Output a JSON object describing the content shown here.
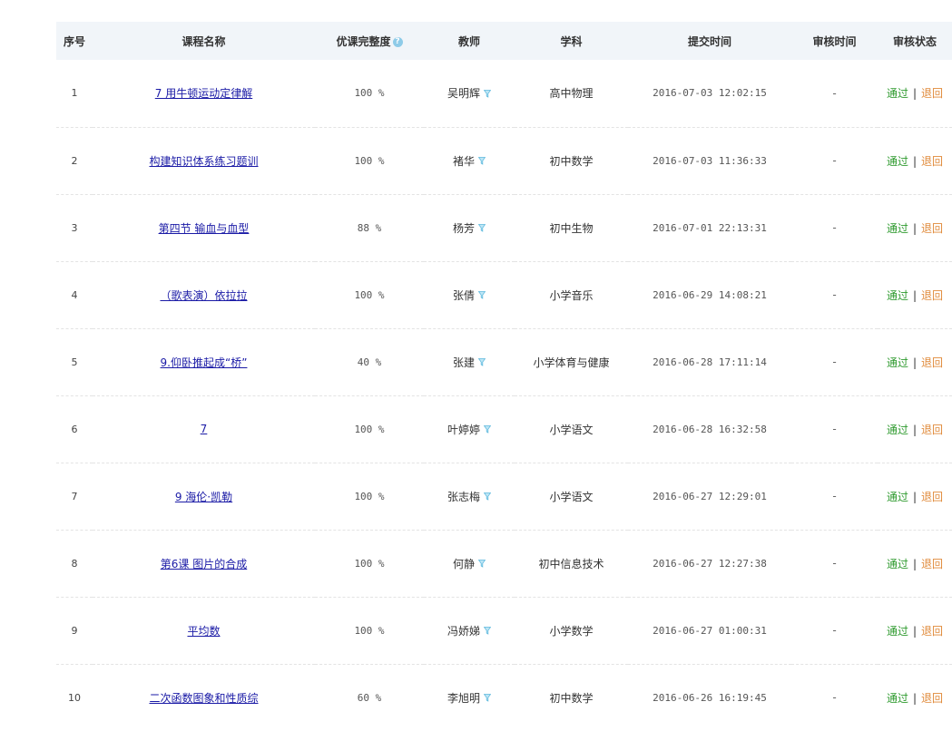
{
  "table": {
    "headers": {
      "idx": "序号",
      "name": "课程名称",
      "completeness": "优课完整度",
      "teacher": "教师",
      "subject": "学科",
      "submit_time": "提交时间",
      "review_time": "审核时间",
      "status": "审核状态"
    },
    "help_glyph": "?",
    "pass_label": "通过",
    "separator": "|",
    "back_label": "退回",
    "rows": [
      {
        "idx": "1",
        "name": "7  用牛顿运动定律解",
        "completeness": "100 %",
        "teacher": "吴明辉",
        "subject": "高中物理",
        "submit_time": "2016-07-03 12:02:15",
        "review_time": "-"
      },
      {
        "idx": "2",
        "name": "构建知识体系练习题训",
        "completeness": "100 %",
        "teacher": "褚华",
        "subject": "初中数学",
        "submit_time": "2016-07-03 11:36:33",
        "review_time": "-"
      },
      {
        "idx": "3",
        "name": "第四节  输血与血型",
        "completeness": "88 %",
        "teacher": "杨芳",
        "subject": "初中生物",
        "submit_time": "2016-07-01 22:13:31",
        "review_time": "-"
      },
      {
        "idx": "4",
        "name": "（歌表演）依拉拉",
        "completeness": "100 %",
        "teacher": "张倩",
        "subject": "小学音乐",
        "submit_time": "2016-06-29 14:08:21",
        "review_time": "-"
      },
      {
        "idx": "5",
        "name": "9.仰卧推起成“桥”",
        "completeness": "40 %",
        "teacher": "张建",
        "subject": "小学体育与健康",
        "submit_time": "2016-06-28 17:11:14",
        "review_time": "-"
      },
      {
        "idx": "6",
        "name": "7",
        "completeness": "100 %",
        "teacher": "叶婷婷",
        "subject": "小学语文",
        "submit_time": "2016-06-28 16:32:58",
        "review_time": "-"
      },
      {
        "idx": "7",
        "name": "9 海伦·凯勒",
        "completeness": "100 %",
        "teacher": "张志梅",
        "subject": "小学语文",
        "submit_time": "2016-06-27 12:29:01",
        "review_time": "-"
      },
      {
        "idx": "8",
        "name": "第6课 图片的合成",
        "completeness": "100 %",
        "teacher": "何静",
        "subject": "初中信息技术",
        "submit_time": "2016-06-27 12:27:38",
        "review_time": "-"
      },
      {
        "idx": "9",
        "name": "平均数",
        "completeness": "100 %",
        "teacher": "冯娇娣",
        "subject": "小学数学",
        "submit_time": "2016-06-27 01:00:31",
        "review_time": "-"
      },
      {
        "idx": "10",
        "name": "二次函数图象和性质综",
        "completeness": "60 %",
        "teacher": "李旭明",
        "subject": "初中数学",
        "submit_time": "2016-06-26 16:19:45",
        "review_time": "-"
      }
    ]
  }
}
